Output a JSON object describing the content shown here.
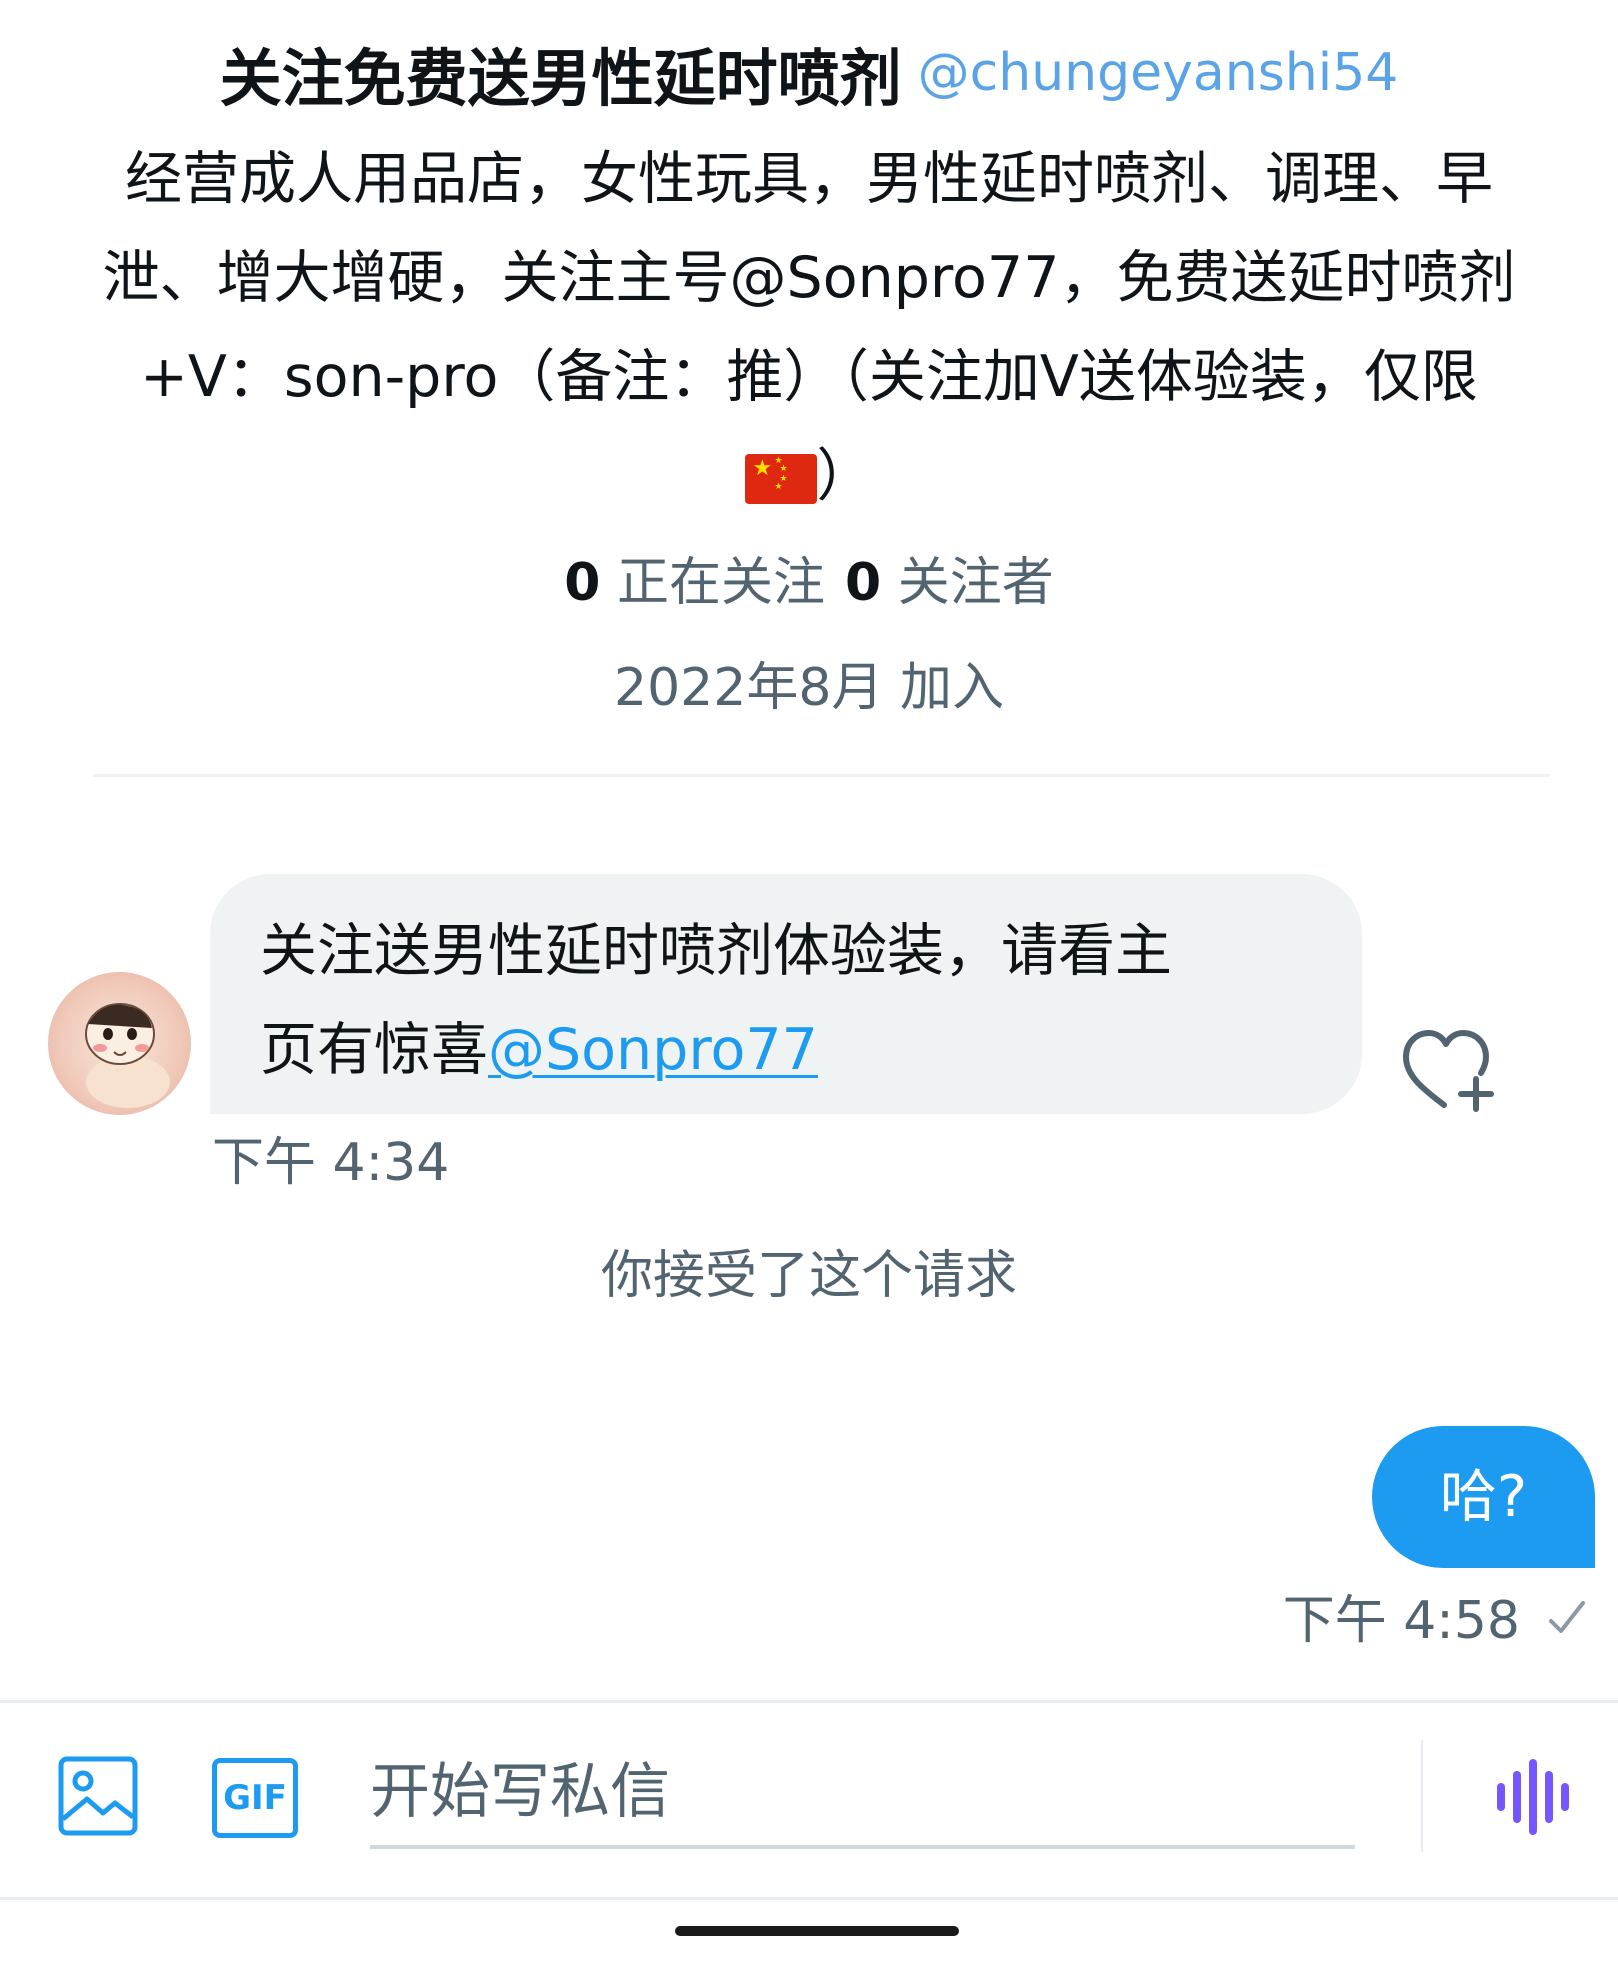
{
  "profile": {
    "display_name": "关注免费送男性延时喷剂",
    "handle": "@chungeyanshi54",
    "bio_lines": [
      "经营成人用品店，女性玩具，男性延时喷剂、调理、早",
      "泄、增大增硬，关注主号@Sonpro77，免费送延时喷剂",
      "+V：son-pro（备注：推）（关注加V送体验装，仅限"
    ],
    "bio_last_suffix": "）",
    "following_count": "0",
    "following_label": "正在关注",
    "followers_count": "0",
    "followers_label": "关注者",
    "joined": "2022年8月 加入"
  },
  "messages": {
    "incoming": {
      "line1": "关注送男性延时喷剂体验装，请看主",
      "line2_prefix": "页有惊喜",
      "mention": "@Sonpro77",
      "time": "下午 4:34"
    },
    "system": "你接受了这个请求",
    "outgoing": {
      "text": "哈?",
      "time": "下午 4:58"
    }
  },
  "composer": {
    "placeholder": "开始写私信",
    "gif_label": "GIF"
  },
  "colors": {
    "accent": "#1d9bf0",
    "handle": "#5aa3e6",
    "secondary_text": "#536471",
    "bubble_incoming": "#eff3f4",
    "voice_icon": "#7856ff"
  },
  "icons": {
    "flag": "china-flag-icon",
    "heart": "heart-plus-icon",
    "check": "check-icon",
    "image": "image-icon",
    "gif": "gif-icon",
    "voice": "voice-waveform-icon"
  }
}
